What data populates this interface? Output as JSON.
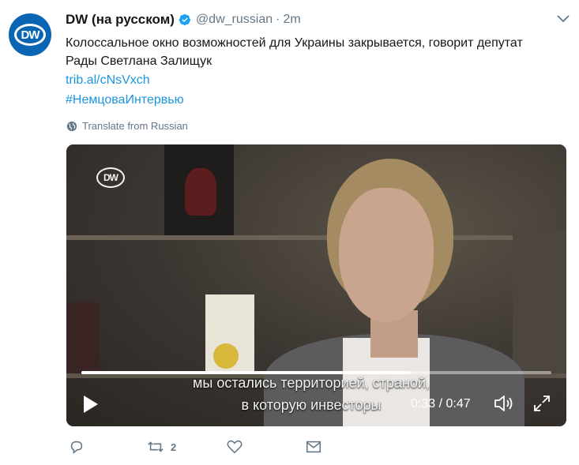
{
  "tweet": {
    "display_name": "DW (на русском)",
    "handle": "@dw_russian",
    "separator": "·",
    "time": "2m",
    "text_line1": "Колоссальное окно возможностей для Украины закрывается, говорит депутат",
    "text_line2": "Рады Светлана Залищук",
    "link": "trib.al/cNsVxch",
    "hashtag": "#НемцоваИнтервью",
    "translate_label": "Translate from Russian",
    "avatar_label": "DW"
  },
  "video": {
    "logo_label": "DW",
    "subtitle_line1": "мы остались территорией, страной,",
    "subtitle_line2": "в которую инвесторы",
    "time_readout": "0:33 / 0:47",
    "progress_fraction": 0.7
  },
  "actions": {
    "retweet_count": "2"
  },
  "colors": {
    "link": "#1b95e0",
    "secondary": "#657786",
    "verified": "#1da1f2",
    "avatar_bg": "#0a66b5"
  }
}
